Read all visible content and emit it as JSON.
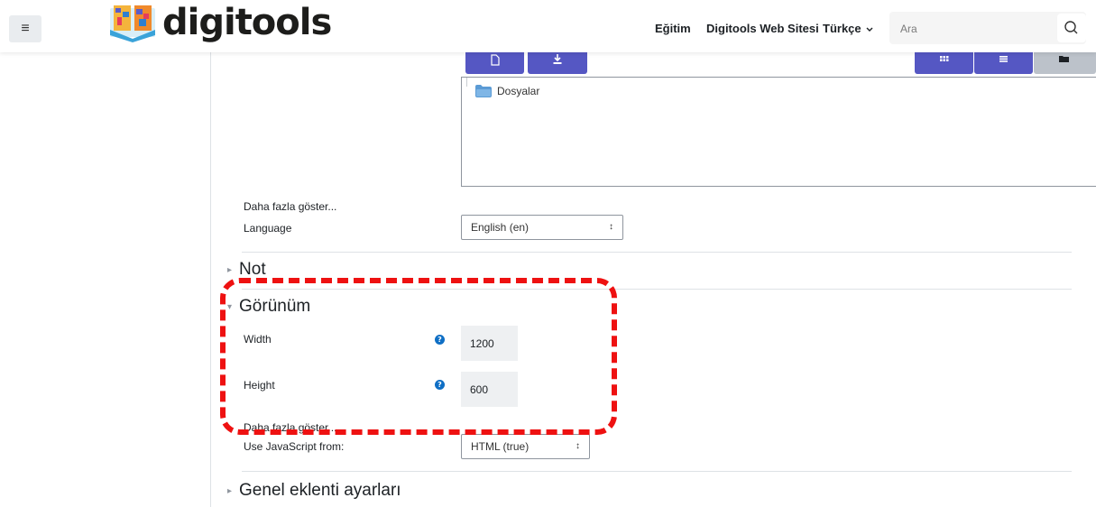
{
  "header": {
    "brand": "digitools",
    "nav_links": [
      "Eğitim",
      "Digitools Web Sitesi",
      "Türkçe"
    ],
    "search_placeholder": "Ara"
  },
  "file_manager": {
    "folder_name": "Dosyalar"
  },
  "form": {
    "show_more_1": "Daha fazla göster...",
    "language_label": "Language",
    "language_value": "English (en)",
    "section_not": "Not",
    "section_gorunum": "Görünüm",
    "width_label": "Width",
    "width_value": "1200",
    "height_label": "Height",
    "height_value": "600",
    "show_more_2": "Daha fazla göster...",
    "js_label": "Use JavaScript from:",
    "js_value": "HTML (true)",
    "section_genel": "Genel eklenti ayarları"
  },
  "colors": {
    "accent": "#5557c3",
    "highlight": "#ee1111",
    "help_icon": "#0f6fc5"
  }
}
